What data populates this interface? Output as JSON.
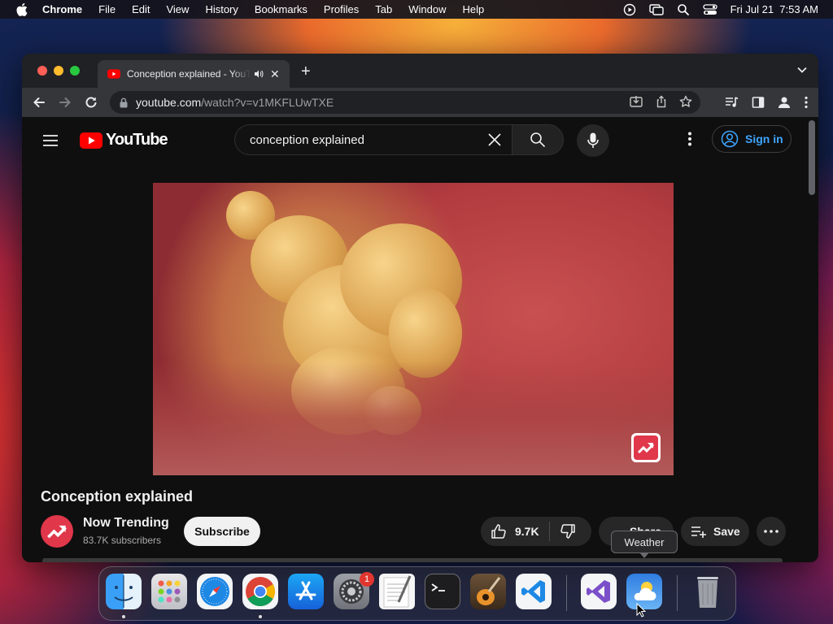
{
  "menubar": {
    "app_name": "Chrome",
    "items": [
      "File",
      "Edit",
      "View",
      "History",
      "Bookmarks",
      "Profiles",
      "Tab",
      "Window",
      "Help"
    ],
    "clock": "Fri Jul 21  7:53 AM"
  },
  "browser": {
    "tab_title": "Conception explained - YouTube",
    "url_host": "youtube.com",
    "url_path": "/watch?v=v1MKFLUwTXE"
  },
  "youtube": {
    "logo_text": "YouTube",
    "search_value": "conception explained",
    "sign_in_label": "Sign in",
    "video_title": "Conception explained",
    "channel_name": "Now Trending",
    "subscribers": "83.7K subscribers",
    "subscribe_label": "Subscribe",
    "like_count": "9.7K",
    "share_label": "Share",
    "save_label": "Save"
  },
  "dock": {
    "tooltip": "Weather",
    "settings_badge": "1",
    "apps": [
      "finder-icon",
      "launchpad-icon",
      "safari-icon",
      "chrome-icon",
      "app-store-icon",
      "system-settings-icon",
      "textedit-icon",
      "terminal-icon",
      "garageband-icon",
      "vscode-icon",
      "visual-studio-icon",
      "weather-icon",
      "trash-icon"
    ]
  },
  "colors": {
    "youtube_red": "#ff0000",
    "link_blue": "#3ea6ff",
    "channel_red": "#e0374a"
  }
}
